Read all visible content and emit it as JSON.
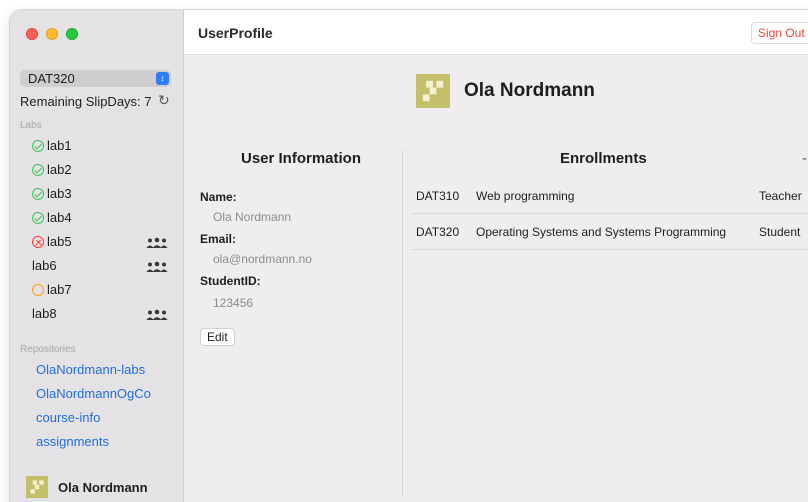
{
  "window": {
    "title": "UserProfile"
  },
  "header": {
    "sign_out_label": "Sign Out"
  },
  "sidebar": {
    "course": "DAT320",
    "remaining_slipdays": "Remaining SlipDays: 7",
    "labs_heading": "Labs",
    "labs": [
      {
        "name": "lab1",
        "status": "passed",
        "group": false
      },
      {
        "name": "lab2",
        "status": "passed",
        "group": false
      },
      {
        "name": "lab3",
        "status": "passed",
        "group": false
      },
      {
        "name": "lab4",
        "status": "passed",
        "group": false
      },
      {
        "name": "lab5",
        "status": "failed",
        "group": true
      },
      {
        "name": "lab6",
        "status": "none",
        "group": true
      },
      {
        "name": "lab7",
        "status": "pending",
        "group": false
      },
      {
        "name": "lab8",
        "status": "none",
        "group": true
      }
    ],
    "repositories_heading": "Repositories",
    "repositories": [
      "OlaNordmann-labs",
      "OlaNordmannOgCo",
      "course-info",
      "assignments"
    ],
    "footer_user_name": "Ola Nordmann"
  },
  "profile": {
    "name": "Ola Nordmann",
    "user_info_heading": "User Information",
    "name_label": "Name:",
    "name_value": "Ola Nordmann",
    "email_label": "Email:",
    "email_value": "ola@nordmann.no",
    "student_id_label": "StudentID:",
    "student_id_value": "123456",
    "edit_label": "Edit"
  },
  "enrollments": {
    "heading": "Enrollments",
    "trailing_mark": "-",
    "rows": [
      {
        "code": "DAT310",
        "name": "Web programming",
        "role": "Teacher"
      },
      {
        "code": "DAT320",
        "name": "Operating Systems and Systems Programming",
        "role": "Student"
      }
    ]
  },
  "colors": {
    "accent_blue": "#1f6fd9",
    "sign_out_red": "#e8463c",
    "passed_green": "#34c759",
    "failed_red": "#ff3b30",
    "pending_orange": "#ff9f0a",
    "avatar_olive": "#c3bf6a"
  }
}
